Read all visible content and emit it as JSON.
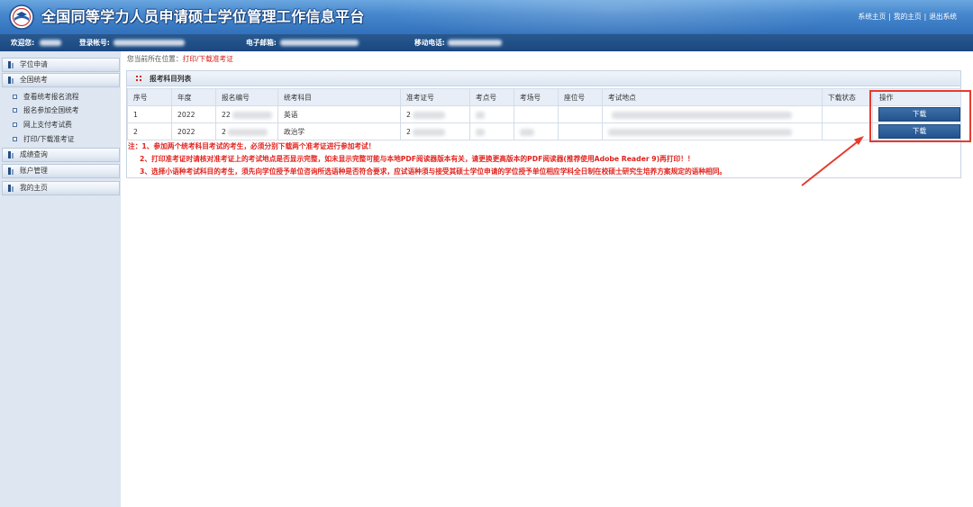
{
  "header": {
    "title": "全国同等学力人员申请硕士学位管理工作信息平台",
    "links": [
      "系统主页",
      "我的主页",
      "退出系统"
    ],
    "separator": "|"
  },
  "userbar": {
    "welcome_label": "欢迎您:",
    "account_label": "登录帐号:",
    "email_label": "电子邮箱:",
    "phone_label": "移动电话:"
  },
  "sidebar": {
    "sections": [
      {
        "label": "学位申请"
      },
      {
        "label": "全国统考",
        "children": [
          "查看统考报名流程",
          "报名参加全国统考",
          "网上支付考试费",
          "打印/下载准考证"
        ]
      },
      {
        "label": "成绩查询"
      },
      {
        "label": "账户管理"
      },
      {
        "label": "我的主页"
      }
    ]
  },
  "breadcrumb": {
    "prefix": "您当前所在位置：",
    "current": "打印/下载准考证"
  },
  "panel": {
    "title": "报考科目列表"
  },
  "table": {
    "columns": [
      "序号",
      "年度",
      "报名编号",
      "统考科目",
      "准考证号",
      "考点号",
      "考场号",
      "座位号",
      "考试地点",
      "下载状态",
      "操作"
    ],
    "rows": [
      {
        "index": "1",
        "year": "2022",
        "reg_no": "22",
        "subject": "英语",
        "ticket_no": "2",
        "action": "下载"
      },
      {
        "index": "2",
        "year": "2022",
        "reg_no": "2",
        "subject": "政治学",
        "ticket_no": "2",
        "action": "下载"
      }
    ]
  },
  "notes": [
    "注：1、参加两个统考科目考试的考生，必须分别下载两个准考证进行参加考试！",
    "2、打印准考证时请核对准考证上的考试地点是否显示完整，如未显示完整可能与本地PDF阅读器版本有关，请更换更高版本的PDF阅读器(推荐使用Adobe Reader 9)再打印！！",
    "3、选择小语种考试科目的考生，须先向学位授予单位咨询所选语种是否符合要求，应试语种须与接受其硕士学位申请的学位授予单位相应学科全日制在校硕士研究生培养方案规定的语种相同。"
  ],
  "icons": {
    "logo": "emblem-logo-icon",
    "section_marker": "section-marker-icon",
    "sub_item": "square-bullet-icon",
    "panel_title": "red-grid-bullet-icon"
  },
  "colors": {
    "banner": "#4687cd",
    "userbar": "#1e4b85",
    "sidebar_bg": "#dde6f1",
    "note_red": "#e1221d",
    "button": "#2b5c97",
    "annotation_red": "#e63b2e"
  }
}
